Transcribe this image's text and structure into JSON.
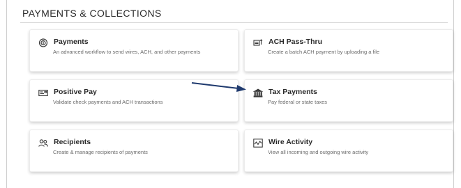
{
  "section": {
    "title": "PAYMENTS & COLLECTIONS"
  },
  "cards": [
    {
      "title": "Payments",
      "description": "An advanced workflow to send wires, ACH, and other payments",
      "icon": "payments-icon"
    },
    {
      "title": "ACH Pass-Thru",
      "description": "Create a batch ACH payment by uploading a file",
      "icon": "upload-file-icon"
    },
    {
      "title": "Positive Pay",
      "description": "Validate check payments and ACH transactions",
      "icon": "check-icon"
    },
    {
      "title": "Tax Payments",
      "description": "Pay federal or state taxes",
      "icon": "government-building-icon"
    },
    {
      "title": "Recipients",
      "description": "Create & manage recipients of payments",
      "icon": "people-icon"
    },
    {
      "title": "Wire Activity",
      "description": "View all incoming and outgoing wire activity",
      "icon": "activity-chart-icon"
    }
  ],
  "annotation": {
    "arrow_color": "#1f3a6e"
  }
}
